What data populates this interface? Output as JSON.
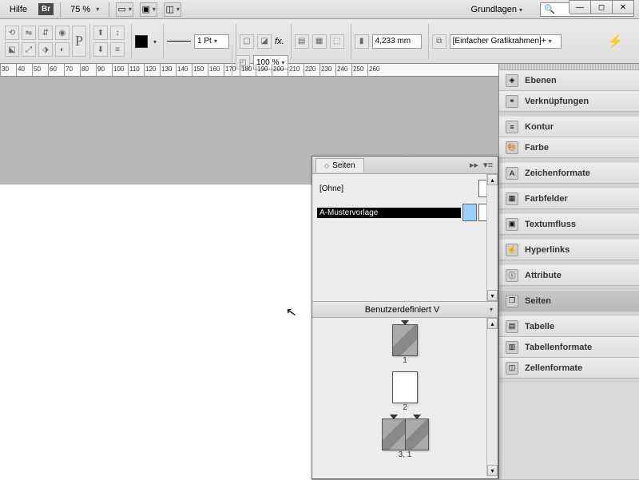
{
  "menu": {
    "help": "Hilfe",
    "bridge": "Br"
  },
  "zoom": {
    "value": "75 %"
  },
  "workspace": {
    "label": "Grundlagen"
  },
  "window_buttons": {
    "min": "—",
    "max": "◻",
    "close": "✕"
  },
  "control_bar": {
    "stroke_weight": "1 Pt",
    "opacity": "100 %",
    "column_width": "4,233 mm",
    "frame_preset": "[Einfacher Grafikrahmen]+"
  },
  "ruler": {
    "ticks": [
      "30",
      "40",
      "50",
      "60",
      "70",
      "80",
      "90",
      "100",
      "110",
      "120",
      "130",
      "140",
      "150",
      "160",
      "170",
      "180",
      "190",
      "200",
      "210",
      "220",
      "230",
      "240",
      "250",
      "260"
    ]
  },
  "pages_panel": {
    "tab": "Seiten",
    "master_none": "[Ohne]",
    "master_a": "A-Mustervorlage",
    "custom": "Benutzerdefiniert V",
    "page_labels": [
      "1",
      "2",
      "3, 1"
    ]
  },
  "right_dock": {
    "items": [
      {
        "icon": "◈",
        "label": "Ebenen"
      },
      {
        "icon": "⚭",
        "label": "Verknüpfungen"
      },
      {
        "icon": "≡",
        "label": "Kontur"
      },
      {
        "icon": "🎨",
        "label": "Farbe"
      },
      {
        "icon": "A",
        "label": "Zeichenformate"
      },
      {
        "icon": "▦",
        "label": "Farbfelder"
      },
      {
        "icon": "▣",
        "label": "Textumfluss"
      },
      {
        "icon": "☝",
        "label": "Hyperlinks"
      },
      {
        "icon": "ⓘ",
        "label": "Attribute"
      },
      {
        "icon": "❐",
        "label": "Seiten",
        "active": true
      },
      {
        "icon": "▤",
        "label": "Tabelle"
      },
      {
        "icon": "▥",
        "label": "Tabellenformate"
      },
      {
        "icon": "◫",
        "label": "Zellenformate"
      }
    ],
    "gaps_after": [
      1,
      3,
      4,
      5,
      6,
      7,
      8,
      9,
      12
    ]
  }
}
